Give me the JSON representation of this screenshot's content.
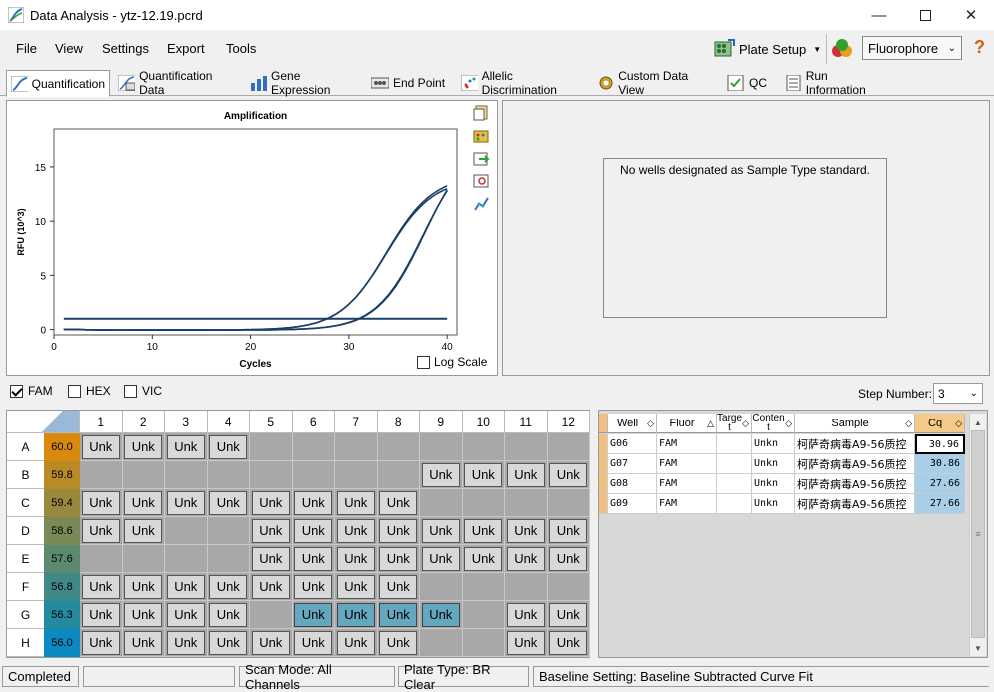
{
  "window": {
    "title": "Data Analysis - ytz-12.19.pcrd"
  },
  "menu": [
    "File",
    "View",
    "Settings",
    "Export",
    "Tools"
  ],
  "toolbar": {
    "plate_setup": "Plate Setup",
    "fluor_select": "Fluorophore"
  },
  "tabs": [
    "Quantification",
    "Quantification Data",
    "Gene Expression",
    "End Point",
    "Allelic Discrimination",
    "Custom Data View",
    "QC",
    "Run Information"
  ],
  "chart_data": {
    "type": "line",
    "title": "Amplification",
    "xlabel": "Cycles",
    "ylabel": "RFU (10^3)",
    "xlim": [
      0,
      41
    ],
    "ylim": [
      -0.5,
      18.5
    ],
    "xticks": [
      0,
      10,
      20,
      30,
      40
    ],
    "yticks": [
      0,
      5,
      10,
      15
    ],
    "threshold": 1.0,
    "series": [
      {
        "well": "G06",
        "cq": 30.96,
        "plateau": 17.8,
        "color": "#1a3f66"
      },
      {
        "well": "G07",
        "cq": 30.86,
        "plateau": 17.4,
        "color": "#1a3f66"
      },
      {
        "well": "G08",
        "cq": 27.66,
        "plateau": 14.3,
        "color": "#1a3f66"
      },
      {
        "well": "G09",
        "cq": 27.66,
        "plateau": 14.0,
        "color": "#1a3f66"
      }
    ]
  },
  "chart_opts": {
    "log_scale_label": "Log Scale",
    "log_scale": false
  },
  "std_message": "No wells designated as Sample Type standard.",
  "fluors": [
    {
      "name": "FAM",
      "checked": true
    },
    {
      "name": "HEX",
      "checked": false
    },
    {
      "name": "VIC",
      "checked": false
    }
  ],
  "step": {
    "label": "Step Number:",
    "value": "3"
  },
  "plate": {
    "cols": [
      "1",
      "2",
      "3",
      "4",
      "5",
      "6",
      "7",
      "8",
      "9",
      "10",
      "11",
      "12"
    ],
    "rows": [
      {
        "label": "A",
        "temp": "60.0",
        "color": "#d9890b",
        "wells": [
          "Unk",
          "Unk",
          "Unk",
          "Unk",
          "",
          "",
          "",
          "",
          "",
          "",
          "",
          ""
        ]
      },
      {
        "label": "B",
        "temp": "59.8",
        "color": "#b98a26",
        "wells": [
          "",
          "",
          "",
          "",
          "",
          "",
          "",
          "",
          "Unk",
          "Unk",
          "Unk",
          "Unk"
        ]
      },
      {
        "label": "C",
        "temp": "59.4",
        "color": "#99893e",
        "wells": [
          "Unk",
          "Unk",
          "Unk",
          "Unk",
          "Unk",
          "Unk",
          "Unk",
          "Unk",
          "",
          "",
          "",
          ""
        ]
      },
      {
        "label": "D",
        "temp": "58.6",
        "color": "#7a8a56",
        "wells": [
          "Unk",
          "Unk",
          "",
          "",
          "Unk",
          "Unk",
          "Unk",
          "Unk",
          "Unk",
          "Unk",
          "Unk",
          "Unk"
        ]
      },
      {
        "label": "E",
        "temp": "57.6",
        "color": "#5b8a6e",
        "wells": [
          "",
          "",
          "",
          "",
          "Unk",
          "Unk",
          "Unk",
          "Unk",
          "Unk",
          "Unk",
          "Unk",
          "Unk"
        ]
      },
      {
        "label": "F",
        "temp": "56.8",
        "color": "#3f8a86",
        "wells": [
          "Unk",
          "Unk",
          "Unk",
          "Unk",
          "Unk",
          "Unk",
          "Unk",
          "Unk",
          "",
          "",
          "",
          ""
        ]
      },
      {
        "label": "G",
        "temp": "56.3",
        "color": "#248a9f",
        "wells": [
          "Unk",
          "Unk",
          "Unk",
          "Unk",
          "",
          "Unk",
          "Unk",
          "Unk",
          "Unk",
          "",
          "Unk",
          "Unk"
        ]
      },
      {
        "label": "H",
        "temp": "56.0",
        "color": "#0a8ac0",
        "wells": [
          "Unk",
          "Unk",
          "Unk",
          "Unk",
          "Unk",
          "Unk",
          "Unk",
          "Unk",
          "",
          "",
          "Unk",
          "Unk"
        ]
      }
    ],
    "selected": [
      "G6",
      "G7",
      "G8",
      "G9"
    ]
  },
  "table": {
    "headers": [
      "Well",
      "Fluor",
      "Target",
      "Content",
      "Sample",
      "Cq"
    ],
    "rows": [
      {
        "well": "G06",
        "fluor": "FAM",
        "target": "",
        "content": "Unkn",
        "sample": "柯萨奇病毒A9-56质控",
        "cq": "30.96"
      },
      {
        "well": "G07",
        "fluor": "FAM",
        "target": "",
        "content": "Unkn",
        "sample": "柯萨奇病毒A9-56质控",
        "cq": "30.86"
      },
      {
        "well": "G08",
        "fluor": "FAM",
        "target": "",
        "content": "Unkn",
        "sample": "柯萨奇病毒A9-56质控",
        "cq": "27.66"
      },
      {
        "well": "G09",
        "fluor": "FAM",
        "target": "",
        "content": "Unkn",
        "sample": "柯萨奇病毒A9-56质控",
        "cq": "27.66"
      }
    ]
  },
  "status": {
    "state": "Completed",
    "scan_mode": "Scan Mode: All Channels",
    "plate_type": "Plate Type: BR Clear",
    "baseline": "Baseline Setting: Baseline Subtracted Curve Fit"
  },
  "colors": {
    "accent": "#66a7c0",
    "cq_highlight": "#a9cfe8"
  }
}
